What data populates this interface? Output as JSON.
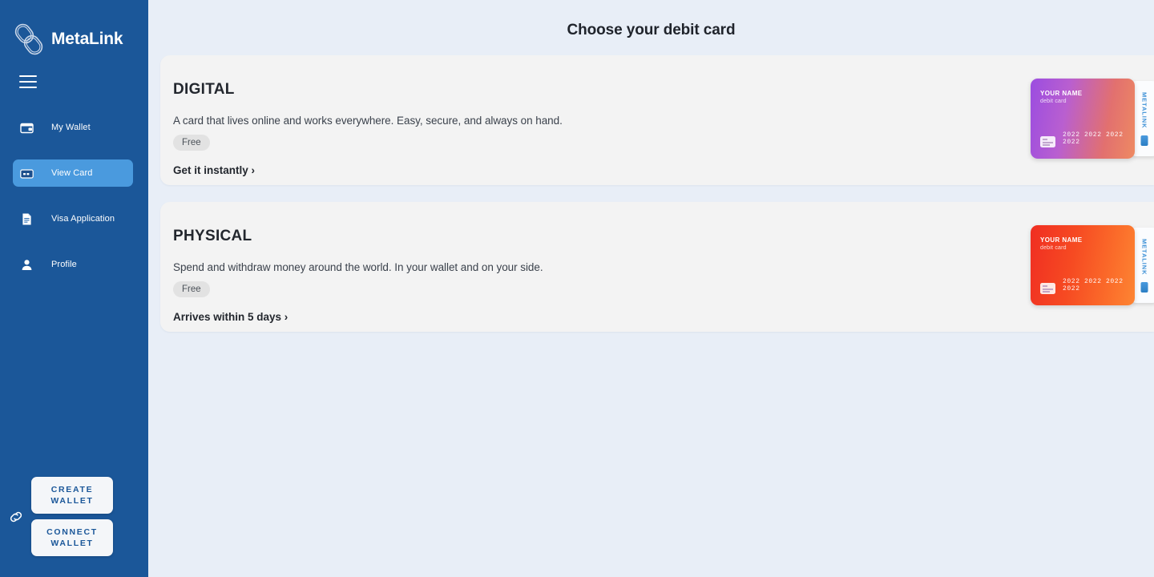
{
  "sidebar": {
    "brand": {
      "name": "MetaLink",
      "logo_icon": "chain-link-icon"
    },
    "menu_toggle_icon": "hamburger-menu-icon",
    "items": [
      {
        "label": "My Wallet",
        "icon": "wallet-icon",
        "active": false
      },
      {
        "label": "View Card",
        "icon": "credit-card-icon",
        "active": true
      },
      {
        "label": "Visa Application",
        "icon": "document-icon",
        "active": false
      },
      {
        "label": "Profile",
        "icon": "user-icon",
        "active": false
      }
    ],
    "wallet": {
      "chain_icon": "chain-link-icon",
      "create_label": "CREATE WALLET",
      "connect_label": "CONNECT WALLET"
    },
    "colors": {
      "background": "#1b5799",
      "active": "#4a9ade",
      "button_text": "#1b5799"
    }
  },
  "main": {
    "title": "Choose your debit card",
    "background": "#e8eef7",
    "cards": [
      {
        "title": "DIGITAL",
        "description": "A card that lives online and works everywhere. Easy, secure, and always on hand.",
        "badge": "Free",
        "link": "Get it instantly ›",
        "art": {
          "holder_name": "YOUR NAME",
          "card_type": "debit card",
          "number": "2022 2022 2022 2022",
          "brand": "METALINK",
          "gradient_from": "#9b4de0",
          "gradient_to": "#ee8a62"
        }
      },
      {
        "title": "PHYSICAL",
        "description": "Spend and withdraw money around the world. In your wallet and on your side.",
        "badge": "Free",
        "link": "Arrives within 5 days ›",
        "art": {
          "holder_name": "YOUR NAME",
          "card_type": "debit card",
          "number": "2022 2022 2022 2022",
          "brand": "METALINK",
          "gradient_from": "#f02e22",
          "gradient_to": "#fd8533"
        }
      }
    ]
  }
}
